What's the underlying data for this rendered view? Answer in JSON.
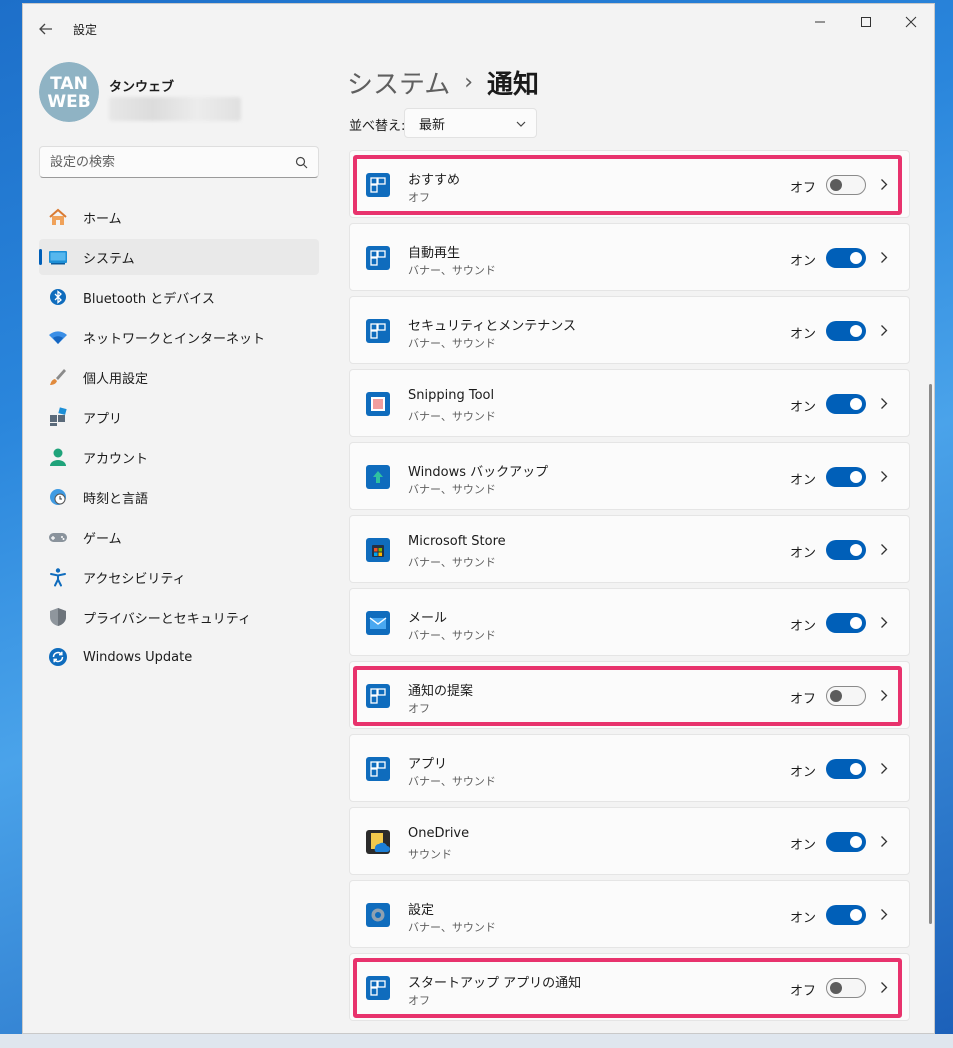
{
  "window": {
    "title": "設定"
  },
  "profile": {
    "logo_text_top": "TAN",
    "logo_text_bottom": "WEB",
    "name": "タンウェブ"
  },
  "search": {
    "placeholder": "設定の検索"
  },
  "nav": [
    {
      "label": "ホーム",
      "icon": "home-icon",
      "selected": false
    },
    {
      "label": "システム",
      "icon": "system-display-icon",
      "selected": true
    },
    {
      "label": "Bluetooth とデバイス",
      "icon": "bluetooth-icon",
      "selected": false
    },
    {
      "label": "ネットワークとインターネット",
      "icon": "wifi-icon",
      "selected": false
    },
    {
      "label": "個人用設定",
      "icon": "paintbrush-icon",
      "selected": false
    },
    {
      "label": "アプリ",
      "icon": "apps-icon",
      "selected": false
    },
    {
      "label": "アカウント",
      "icon": "account-icon",
      "selected": false
    },
    {
      "label": "時刻と言語",
      "icon": "clock-globe-icon",
      "selected": false
    },
    {
      "label": "ゲーム",
      "icon": "gamepad-icon",
      "selected": false
    },
    {
      "label": "アクセシビリティ",
      "icon": "accessibility-icon",
      "selected": false
    },
    {
      "label": "プライバシーとセキュリティ",
      "icon": "shield-icon",
      "selected": false
    },
    {
      "label": "Windows Update",
      "icon": "windows-update-icon",
      "selected": false
    }
  ],
  "breadcrumb": {
    "parent": "システム",
    "separator": "›",
    "current": "通知"
  },
  "sort": {
    "label": "並べ替え:",
    "value": "最新"
  },
  "notifications": [
    {
      "title": "おすすめ",
      "sub": "オフ",
      "state": "オフ",
      "on": false,
      "icon": "app-tile-icon",
      "highlighted": true
    },
    {
      "title": "自動再生",
      "sub": "バナー、サウンド",
      "state": "オン",
      "on": true,
      "icon": "app-tile-icon",
      "highlighted": false
    },
    {
      "title": "セキュリティとメンテナンス",
      "sub": "バナー、サウンド",
      "state": "オン",
      "on": true,
      "icon": "app-tile-icon",
      "highlighted": false
    },
    {
      "title": "Snipping Tool",
      "sub": "バナー、サウンド",
      "state": "オン",
      "on": true,
      "icon": "snipping-tool-icon",
      "highlighted": false
    },
    {
      "title": "Windows バックアップ",
      "sub": "バナー、サウンド",
      "state": "オン",
      "on": true,
      "icon": "backup-icon",
      "highlighted": false
    },
    {
      "title": "Microsoft Store",
      "sub": "バナー、サウンド",
      "state": "オン",
      "on": true,
      "icon": "store-icon",
      "highlighted": false
    },
    {
      "title": "メール",
      "sub": "バナー、サウンド",
      "state": "オン",
      "on": true,
      "icon": "mail-icon",
      "highlighted": false
    },
    {
      "title": "通知の提案",
      "sub": "オフ",
      "state": "オフ",
      "on": false,
      "icon": "app-tile-icon",
      "highlighted": true
    },
    {
      "title": "アプリ",
      "sub": "バナー、サウンド",
      "state": "オン",
      "on": true,
      "icon": "app-tile-icon",
      "highlighted": false
    },
    {
      "title": "OneDrive",
      "sub": "サウンド",
      "state": "オン",
      "on": true,
      "icon": "onedrive-icon",
      "highlighted": false
    },
    {
      "title": "設定",
      "sub": "バナー、サウンド",
      "state": "オン",
      "on": true,
      "icon": "settings-gear-icon",
      "highlighted": false
    },
    {
      "title": "スタートアップ アプリの通知",
      "sub": "オフ",
      "state": "オフ",
      "on": false,
      "icon": "app-tile-icon",
      "highlighted": true
    }
  ],
  "colors": {
    "accent": "#005fb8",
    "highlight": "#e8336d",
    "window_bg": "#f3f3f3"
  }
}
